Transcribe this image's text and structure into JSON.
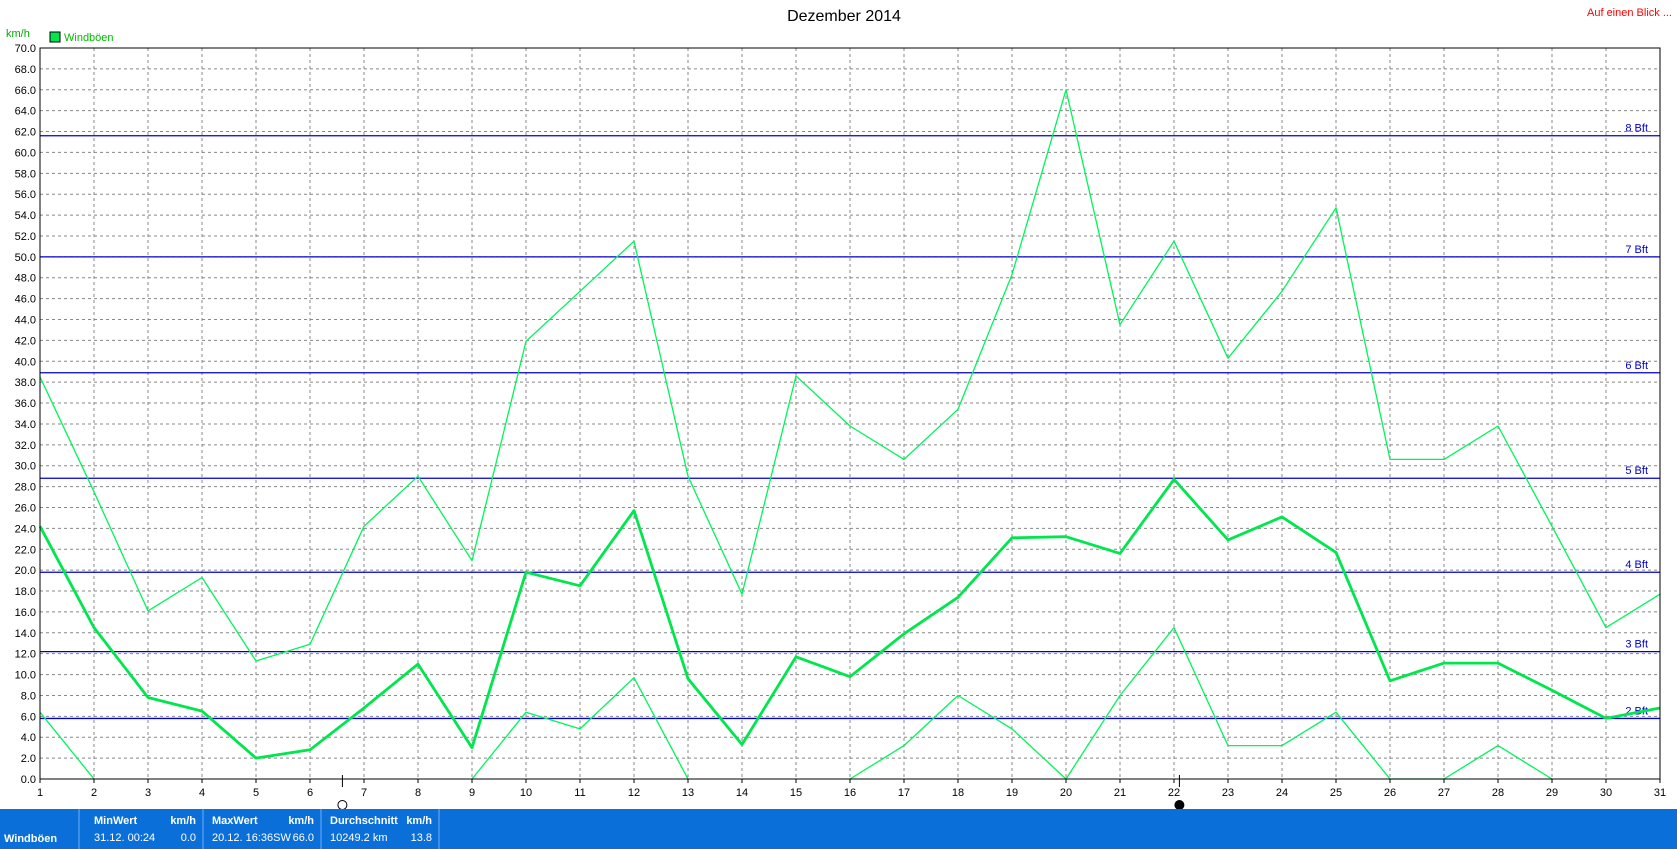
{
  "page": {
    "title": "Dezember 2014",
    "unit": "km/h",
    "link": "Auf einen Blick ..."
  },
  "chart_data": {
    "type": "line",
    "title": "Dezember 2014",
    "ylabel": "km/h",
    "xlabel": "",
    "x": [
      1,
      2,
      3,
      4,
      5,
      6,
      7,
      8,
      9,
      10,
      11,
      12,
      13,
      14,
      15,
      16,
      17,
      18,
      19,
      20,
      21,
      22,
      23,
      24,
      25,
      26,
      27,
      28,
      29,
      30,
      31
    ],
    "xlim": [
      1,
      31
    ],
    "ylim": [
      0,
      70
    ],
    "ytick_step": 2,
    "grid": true,
    "legend": {
      "placement": "top-left",
      "entries": [
        "Windböen"
      ]
    },
    "series": [
      {
        "name": "Windböen",
        "role": "mean",
        "color": "#00e64d",
        "values": [
          24.2,
          14.5,
          7.8,
          6.5,
          2.0,
          2.8,
          6.8,
          11.0,
          3.0,
          19.8,
          18.5,
          25.7,
          9.6,
          3.3,
          11.7,
          9.8,
          13.9,
          17.4,
          23.1,
          23.2,
          21.6,
          28.7,
          22.9,
          25.1,
          21.7,
          9.4,
          11.1,
          11.1,
          8.5,
          5.8,
          6.8
        ]
      },
      {
        "name": "",
        "role": "max",
        "color": "#00f55a",
        "values": [
          38.5,
          27.5,
          16.1,
          19.3,
          11.3,
          12.9,
          24.2,
          29.0,
          20.9,
          41.9,
          46.7,
          51.5,
          29.0,
          17.7,
          38.6,
          33.8,
          30.6,
          35.4,
          48.3,
          66.0,
          43.5,
          51.5,
          40.3,
          46.7,
          54.7,
          30.6,
          30.6,
          33.8,
          24.2,
          14.5,
          17.7
        ]
      },
      {
        "name": "",
        "role": "min",
        "color": "#00f55a",
        "values": [
          6.4,
          0.0,
          null,
          null,
          null,
          null,
          null,
          null,
          0.0,
          6.4,
          4.8,
          9.7,
          0.0,
          null,
          null,
          0.0,
          3.2,
          8.0,
          4.8,
          0.0,
          8.0,
          14.5,
          3.2,
          3.2,
          6.4,
          0.0,
          0.0,
          3.2,
          0.0,
          null,
          null
        ]
      }
    ],
    "reference_lines": [
      {
        "label": "2 Bft",
        "value": 5.8
      },
      {
        "label": "3 Bft",
        "value": 12.2
      },
      {
        "label": "4 Bft",
        "value": 19.8
      },
      {
        "label": "5 Bft",
        "value": 28.8
      },
      {
        "label": "6 Bft",
        "value": 38.9
      },
      {
        "label": "7 Bft",
        "value": 50.0
      },
      {
        "label": "8 Bft",
        "value": 61.6
      }
    ],
    "moon_phases": [
      {
        "day": 6.6,
        "phase": "full-moon"
      },
      {
        "day": 22.1,
        "phase": "new-moon"
      }
    ]
  },
  "summary": {
    "label": "Windböen",
    "min": {
      "header": "MinWert",
      "unit": "km/h",
      "time": "31.12.  00:24",
      "value": "0.0"
    },
    "max": {
      "header": "MaxWert",
      "unit": "km/h",
      "time": "20.12.  16:36SW",
      "value": "66.0"
    },
    "avg": {
      "header": "Durchschnitt",
      "unit": "km/h",
      "time": "10249.2 km",
      "value": "13.8"
    }
  },
  "colors": {
    "line": "#00e64d",
    "bft_line": "#0000cc",
    "footer_bg": "#0a6fd8",
    "link": "#ff0000"
  }
}
